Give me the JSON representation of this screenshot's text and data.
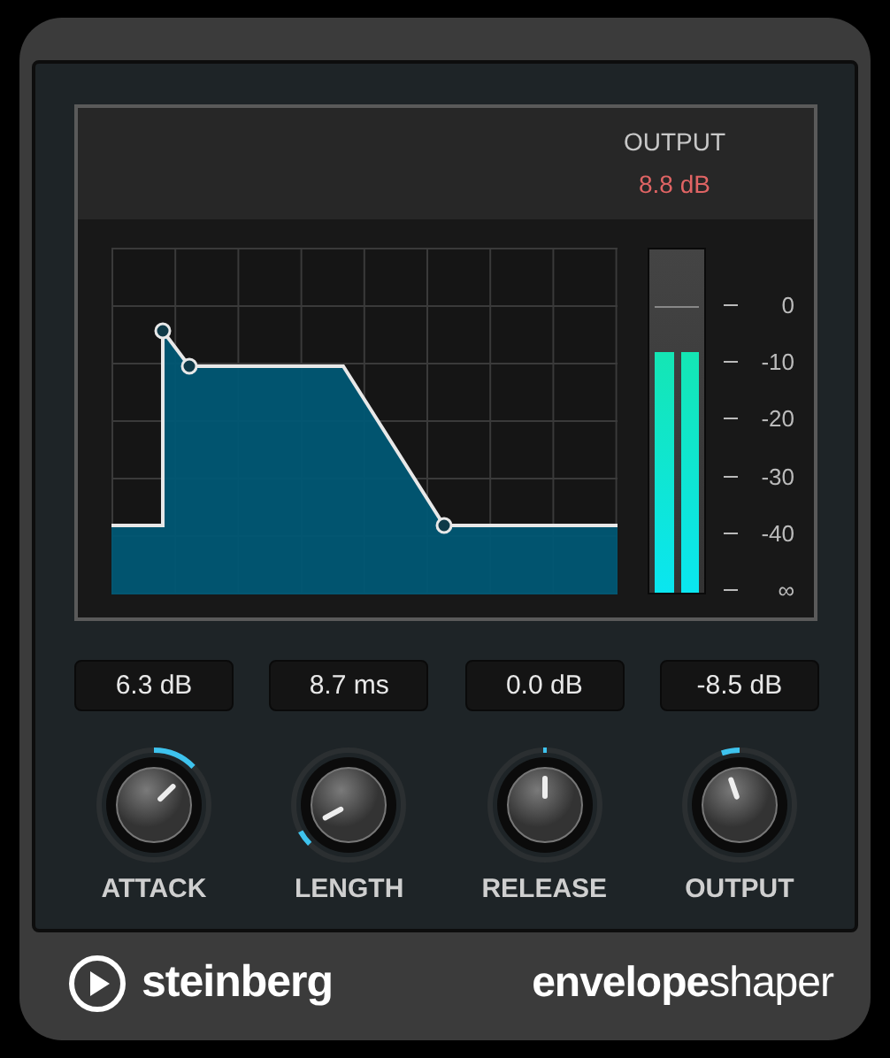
{
  "display": {
    "output_label": "OUTPUT",
    "output_value": "8.8 dB",
    "meters": [
      {
        "level": 0.7
      },
      {
        "level": 0.7
      }
    ],
    "scale": [
      "0",
      "-10",
      "-20",
      "-30",
      "-40",
      "∞"
    ]
  },
  "controls": [
    {
      "value": "6.3 dB",
      "label": "ATTACK"
    },
    {
      "value": "8.7 ms",
      "label": "LENGTH"
    },
    {
      "value": "0.0 dB",
      "label": "RELEASE"
    },
    {
      "value": "-8.5 dB",
      "label": "OUTPUT"
    }
  ],
  "footer": {
    "brand": "steinberg",
    "product": "**envelope**shaper"
  }
}
